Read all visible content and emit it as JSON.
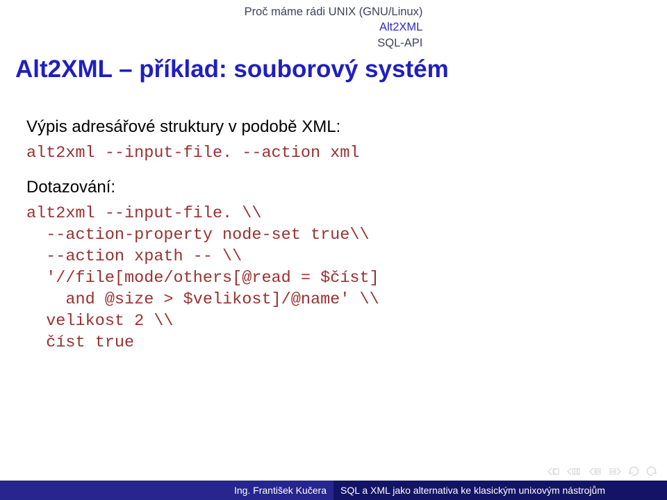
{
  "header": {
    "section1": "Proč máme rádi UNIX (GNU/Linux)",
    "section2": "Alt2XML",
    "section3": "SQL-API"
  },
  "frametitle": "Alt2XML – příklad: souborový systém",
  "body": {
    "para1": "Výpis adresářové struktury v podobě XML:",
    "code1": "alt2xml --input-file. --action xml",
    "para2": "Dotazování:",
    "code2_l1": "alt2xml --input-file. \\\\",
    "code2_l2": "--action-property node-set true\\\\",
    "code2_l3": "--action xpath -- \\\\",
    "code2_l4": "'//file[mode/others[@read = $číst]",
    "code2_l5": "and @size > $velikost]/@name' \\\\",
    "code2_l6": "velikost 2 \\\\",
    "code2_l7": "číst true"
  },
  "footer": {
    "author": "Ing. František Kučera",
    "title": "SQL a XML jako alternativa ke klasickým unixovým nástrojům"
  }
}
